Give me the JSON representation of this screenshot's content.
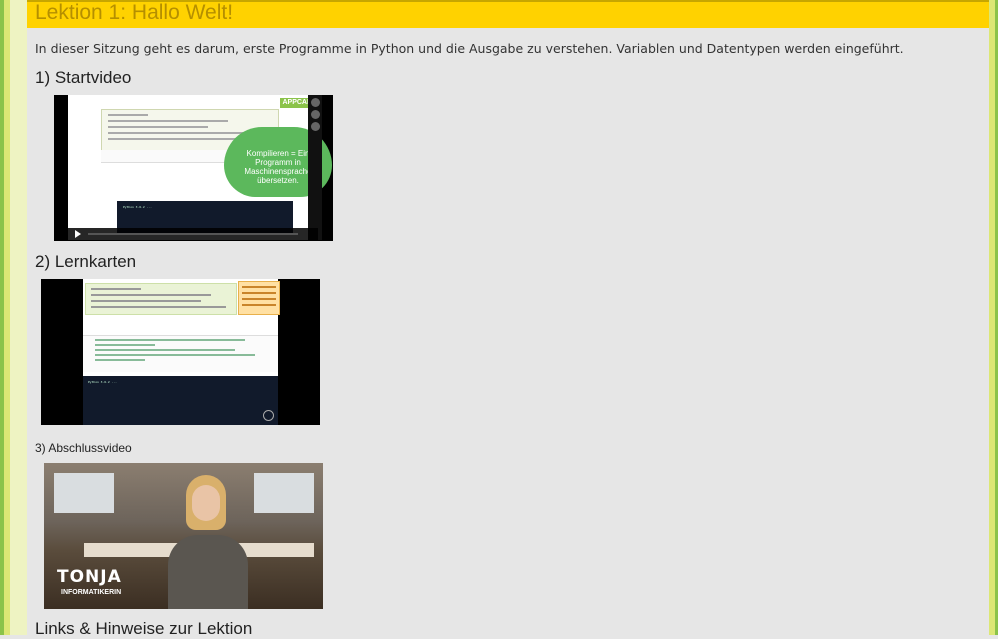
{
  "lesson": {
    "title": "Lektion 1: Hallo Welt!",
    "intro": "In dieser Sitzung geht es darum, erste Programme in Python und die Ausgabe zu verstehen. Variablen und Datentypen werden eingeführt."
  },
  "sections": {
    "startvideo": "1) Startvideo",
    "lernkarten": "2) Lernkarten",
    "abschlussvideo": "3) Abschlussvideo",
    "links": "Links & Hinweise zur Lektion"
  },
  "video1": {
    "brand": "APPCAMP",
    "bubble": [
      "Kompilieren = Ein",
      "Programm in",
      "Maschinensprache",
      "übersetzen."
    ]
  },
  "video3": {
    "name": "TONJA",
    "role": "INFORMATIKERIN"
  },
  "colors": {
    "title_bar": "#ffd200",
    "title_text": "#b58f00",
    "accent_green": "#8bc34a",
    "bubble_green": "#5cb85c"
  }
}
